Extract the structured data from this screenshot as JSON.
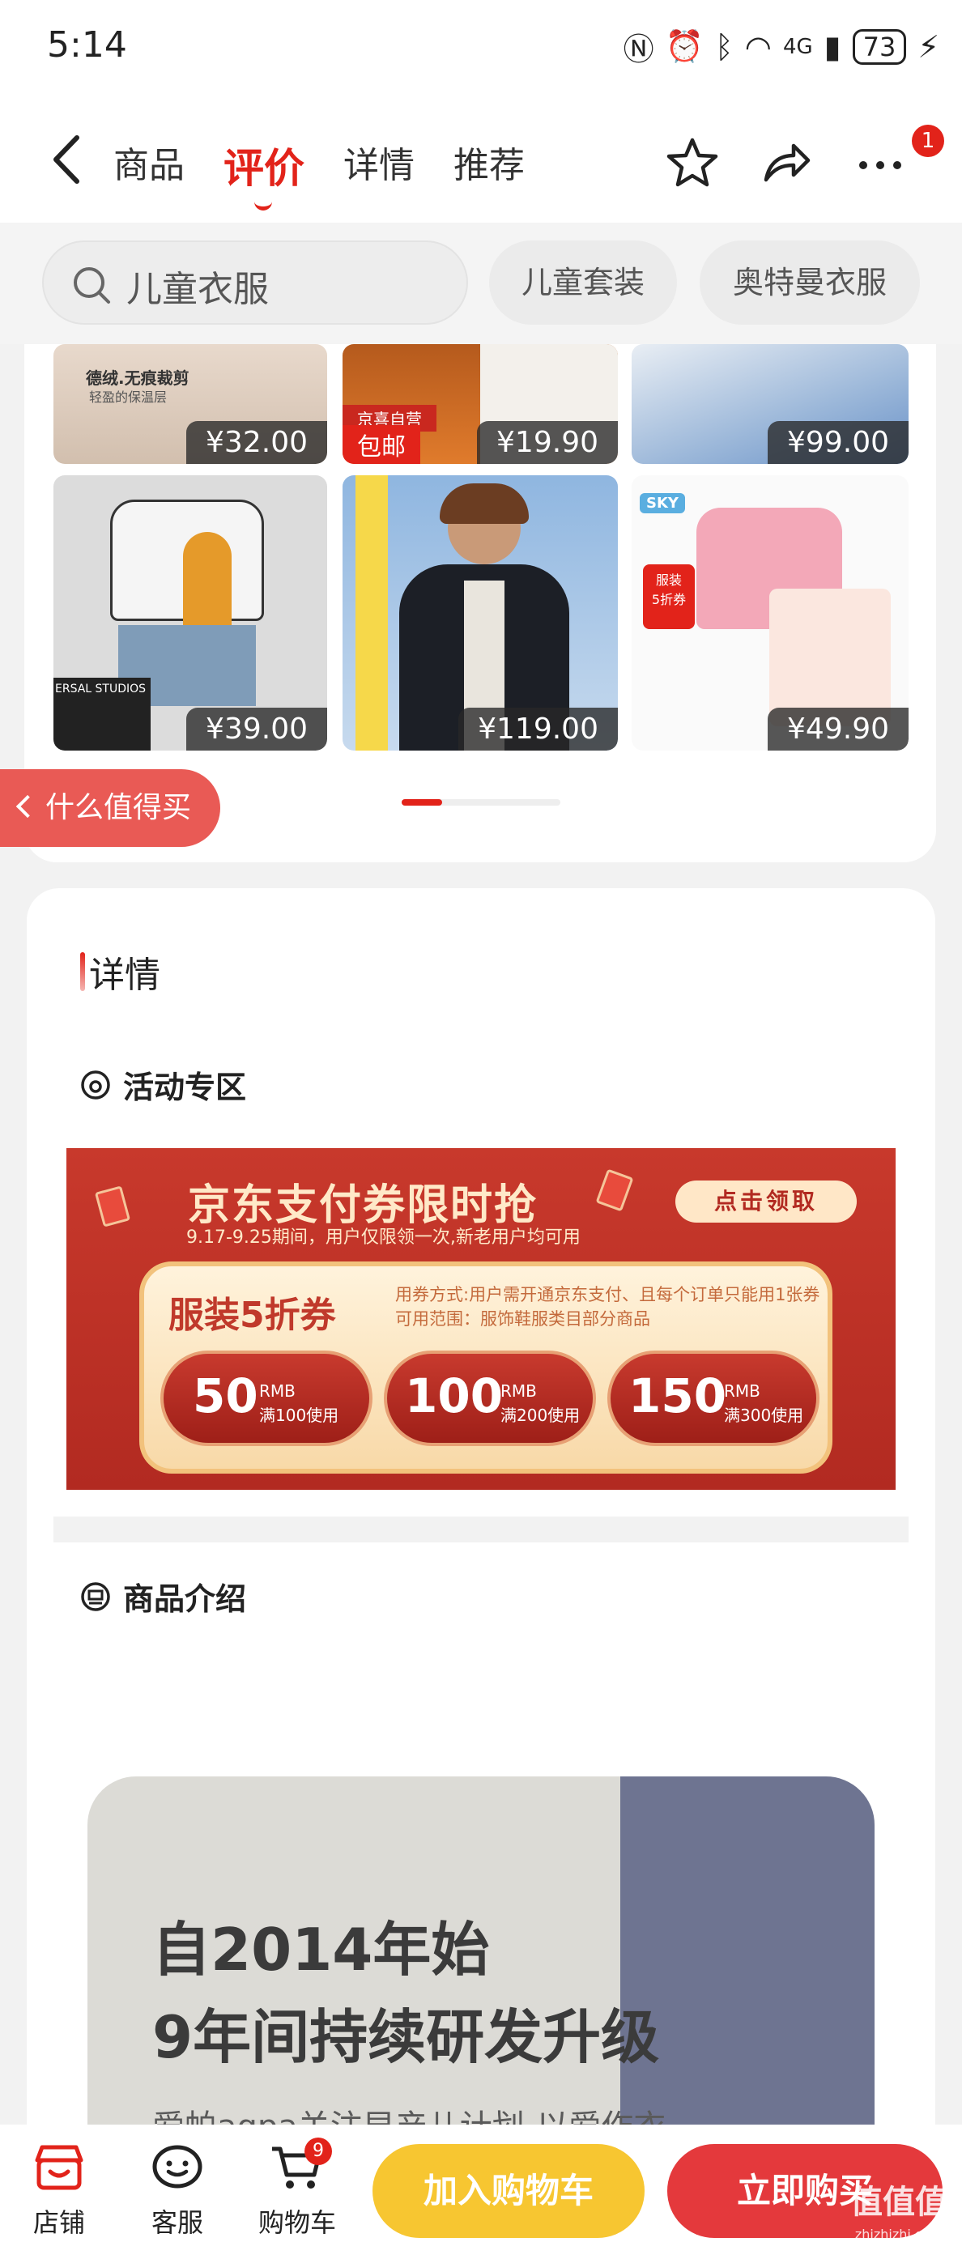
{
  "status_bar": {
    "time": "5:14",
    "network": "4G",
    "battery": "73"
  },
  "nav": {
    "tabs": [
      "商品",
      "评价",
      "详情",
      "推荐"
    ],
    "active_tab": "评价",
    "more_badge": "1"
  },
  "search": {
    "query": "儿童衣服",
    "chips": [
      "儿童套装",
      "奥特曼衣服"
    ]
  },
  "recommendations": {
    "row1": [
      {
        "price": "¥32.00",
        "caption": "德绒.无痕裁剪",
        "caption2": "轻盈的保温层"
      },
      {
        "price": "¥19.90",
        "tag": "包邮",
        "tag_top": "京喜自营"
      },
      {
        "price": "¥99.00"
      }
    ],
    "row2": [
      {
        "price": "¥39.00",
        "caption": "ERSAL STUDIOS"
      },
      {
        "price": "¥119.00"
      },
      {
        "price": "¥49.90",
        "logo": "SKY",
        "promo": "服装\n5折券"
      }
    ],
    "worth_buying": "什么值得买"
  },
  "details": {
    "title": "详情",
    "activity_section": "活动专区",
    "intro_section": "商品介绍"
  },
  "banner": {
    "title": "京东支付券限时抢",
    "subtitle": "9.17-9.25期间，用户仅限领一次,新老用户均可用",
    "grab_button": "点击领取",
    "coupon_name": "服装5折券",
    "rule1": "用券方式:用户需开通京东支付、且每个订单只能用1张券",
    "rule2": "可用范围：服饰鞋服类目部分商品",
    "coupons": [
      {
        "amount": "50",
        "unit": "RMB",
        "condition": "满100使用"
      },
      {
        "amount": "100",
        "unit": "RMB",
        "condition": "满200使用"
      },
      {
        "amount": "150",
        "unit": "RMB",
        "condition": "满300使用"
      }
    ]
  },
  "intro": {
    "line1": "自2014年始",
    "line2": "9年间持续研发升级",
    "line3": "爱帕aqpa关注早产儿计划-以爱作衣"
  },
  "bottom_bar": {
    "shop": "店铺",
    "service": "客服",
    "cart": "购物车",
    "cart_count": "9",
    "add_to_cart": "加入购物车",
    "buy_now": "立即购买"
  },
  "watermark": {
    "text": "值值值",
    "url": "zhizhizhi.com"
  },
  "colors": {
    "accent": "#e2231a",
    "add_cart": "#f7c631",
    "buy_now": "#e4393c"
  }
}
